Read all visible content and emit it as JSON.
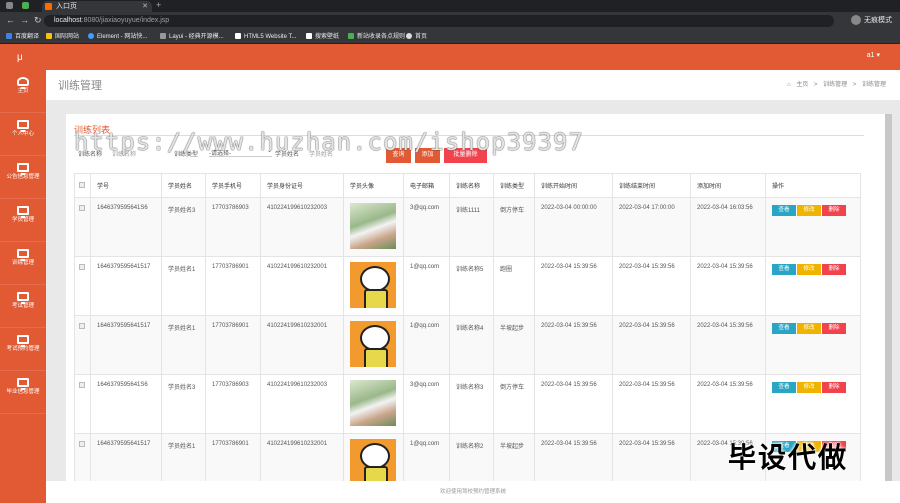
{
  "browser": {
    "tab_title": "入口页",
    "url_host": "localhost",
    "url_rest": ":8080/jiaxiaoyuyue/index.jsp",
    "profile": "无痕模式",
    "bookmarks": [
      "百度翻译",
      "国际网站",
      "Element - 网站快...",
      "Layui - 经典开源模...",
      "HTML5 Website T...",
      "搜索壁纸",
      "新站收录各点规则",
      "首页"
    ]
  },
  "app": {
    "logo": "μ",
    "user_label": "a1 ▾",
    "sidebar": [
      "主页",
      "个人中心",
      "公告信息管理",
      "学员管理",
      "训练管理",
      "考试管理",
      "考试预约管理",
      "毕业信息管理"
    ],
    "page_title": "训练管理",
    "breadcrumb": [
      "主页",
      ">",
      "训练管理",
      ">",
      "训练管理"
    ],
    "list_title": "训练列表",
    "search": {
      "name_label": "训练名称",
      "name_placeholder": "训练名称",
      "type_label": "训练类型",
      "type_select": "-请选择-",
      "student_label": "学员姓名",
      "student_placeholder": "学员姓名",
      "query_btn": "查询",
      "add_btn": "添加",
      "batch_delete_btn": "批量删除"
    },
    "columns": [
      "学号",
      "学员姓名",
      "学员手机号",
      "学员身份证号",
      "学员头像",
      "电子邮箱",
      "训练名称",
      "训练类型",
      "训练开始时间",
      "训练结束时间",
      "添加时间",
      "操作"
    ],
    "action_labels": {
      "view": "查看",
      "edit": "修改",
      "delete": "删除"
    },
    "rows": [
      {
        "id": "1646379595641S6",
        "name": "学员姓名3",
        "phone": "17703786903",
        "idcard": "410224199610232003",
        "email": "3@qq.com",
        "train": "训练1111",
        "type": "倒方停车",
        "start": "2022-03-04 00:00:00",
        "end": "2022-03-04 17:00:00",
        "added": "2022-03-04 16:03:56",
        "avatar": "photo"
      },
      {
        "id": "1646379595641517",
        "name": "学员姓名1",
        "phone": "17703786901",
        "idcard": "410224199610232001",
        "email": "1@qq.com",
        "train": "训练名称5",
        "type": "跑圈",
        "start": "2022-03-04 15:39:56",
        "end": "2022-03-04 15:39:56",
        "added": "2022-03-04 15:39:56",
        "avatar": "cartoon"
      },
      {
        "id": "1646379595641517",
        "name": "学员姓名1",
        "phone": "17703786901",
        "idcard": "410224199610232001",
        "email": "1@qq.com",
        "train": "训练名称4",
        "type": "半坡起步",
        "start": "2022-03-04 15:39:56",
        "end": "2022-03-04 15:39:56",
        "added": "2022-03-04 15:39:56",
        "avatar": "cartoon"
      },
      {
        "id": "1646379595641S6",
        "name": "学员姓名3",
        "phone": "17703786903",
        "idcard": "410224199610232003",
        "email": "3@qq.com",
        "train": "训练名称3",
        "type": "倒方停车",
        "start": "2022-03-04 15:39:56",
        "end": "2022-03-04 15:39:56",
        "added": "2022-03-04 15:39:56",
        "avatar": "photo"
      },
      {
        "id": "1646379595641517",
        "name": "学员姓名1",
        "phone": "17703786901",
        "idcard": "410224199610232001",
        "email": "1@qq.com",
        "train": "训练名称2",
        "type": "半坡起步",
        "start": "2022-03-04 15:39:56",
        "end": "2022-03-04 15:39:56",
        "added": "2022-03-04 15:39:56",
        "avatar": "cartoon"
      }
    ],
    "footer": "欢迎使用驾校预约管理系统"
  },
  "watermark": "https://www.huzhan.com/ishop39397",
  "watermark2": "毕设代做",
  "colors": {
    "primary": "#e15a33",
    "view": "#2aa6c4",
    "edit": "#f0b400",
    "delete": "#f2434d"
  }
}
